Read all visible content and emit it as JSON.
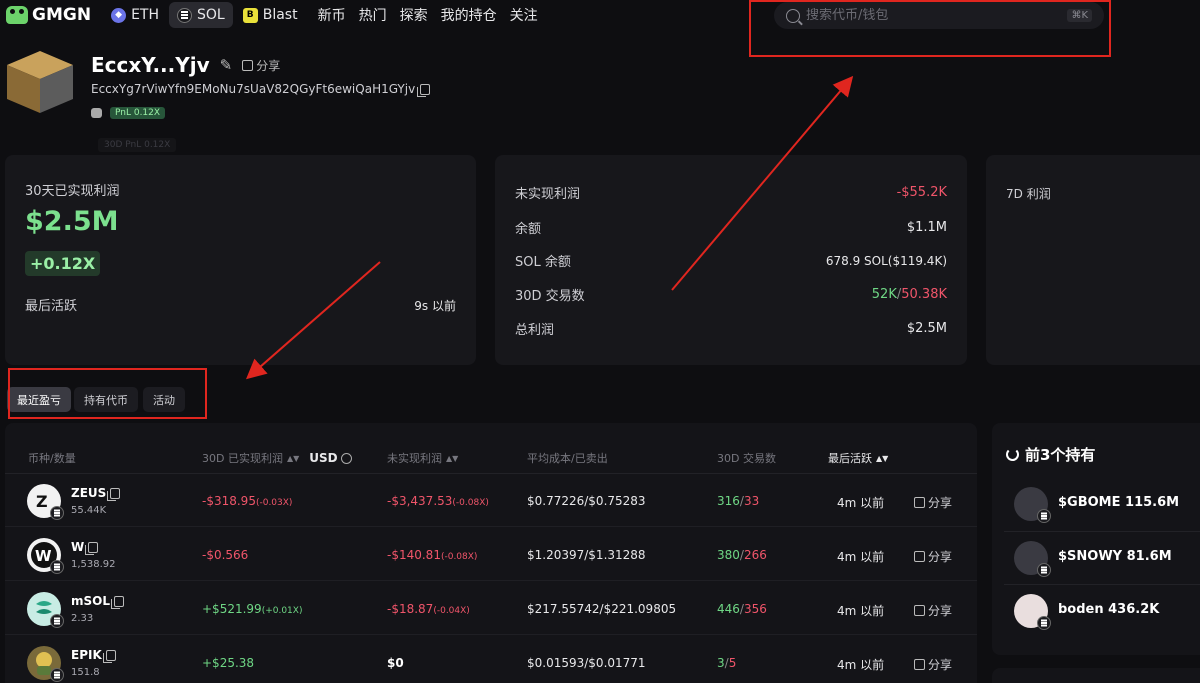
{
  "nav": {
    "logo": "GMGN",
    "chains": [
      {
        "label": "ETH",
        "active": false
      },
      {
        "label": "SOL",
        "active": true
      },
      {
        "label": "Blast",
        "active": false
      }
    ],
    "links": [
      "新币",
      "热门",
      "探索",
      "我的持仓",
      "关注"
    ],
    "search_placeholder": "搜索代币/钱包",
    "search_shortcut": "⌘K"
  },
  "profile": {
    "name": "EccxY...Yjv",
    "share_label": "分享",
    "address": "EccxYg7rViwYfn9EMoNu7sUaV82QGyFt6ewiQaH1GYjv",
    "pnl_badge": "PnL 0.12X",
    "pnl_faded": "30D PnL 0.12X"
  },
  "card_realized": {
    "label": "30天已实现利润",
    "value": "$2.5M",
    "multiplier": "+0.12X",
    "last_active_label": "最后活跃",
    "last_active_value": "9s 以前"
  },
  "card_stats": {
    "unrealized_label": "未实现利润",
    "unrealized_value": "-$55.2K",
    "balance_label": "余额",
    "balance_value": "$1.1M",
    "sol_balance_label": "SOL 余额",
    "sol_balance_value": "678.9 SOL($119.4K)",
    "tx_label": "30D 交易数",
    "tx_buy": "52K",
    "tx_sell": "50.38K",
    "total_profit_label": "总利润",
    "total_profit_value": "$2.5M"
  },
  "card_7d": {
    "label": "7D 利润"
  },
  "tabs": [
    {
      "label": "最近盈亏",
      "active": true
    },
    {
      "label": "持有代币",
      "active": false
    },
    {
      "label": "活动",
      "active": false
    }
  ],
  "table": {
    "headers": {
      "token": "币种/数量",
      "realized": "30D 已实现利润",
      "currency": "USD",
      "unrealized": "未实现利润",
      "avg_cost": "平均成本/已卖出",
      "trades": "30D 交易数",
      "last_active": "最后活跃"
    },
    "rows": [
      {
        "name": "ZEUS",
        "qty": "55.44K",
        "realized": "-$318.95",
        "realized_mult": "(-0.03X)",
        "unrealized": "-$3,437.53",
        "unrealized_mult": "(-0.08X)",
        "avg_cost": "$0.77226/$0.75283",
        "buys": "316",
        "sells": "33",
        "time": "4m 以前",
        "share": "分享"
      },
      {
        "name": "W",
        "qty": "1,538.92",
        "realized": "-$0.566",
        "realized_mult": "",
        "unrealized": "-$140.81",
        "unrealized_mult": "(-0.08X)",
        "avg_cost": "$1.20397/$1.31288",
        "buys": "380",
        "sells": "266",
        "time": "4m 以前",
        "share": "分享"
      },
      {
        "name": "mSOL",
        "qty": "2.33",
        "realized": "+$521.99",
        "realized_mult": "(+0.01X)",
        "unrealized": "-$18.87",
        "unrealized_mult": "(-0.04X)",
        "avg_cost": "$217.55742/$221.09805",
        "buys": "446",
        "sells": "356",
        "time": "4m 以前",
        "share": "分享"
      },
      {
        "name": "EPIK",
        "qty": "151.8",
        "realized": "+$25.38",
        "realized_mult": "",
        "unrealized": "$0",
        "unrealized_mult": "",
        "avg_cost": "$0.01593/$0.01771",
        "buys": "3",
        "sells": "5",
        "time": "4m 以前",
        "share": "分享"
      }
    ]
  },
  "top_holdings": {
    "title": "前3个持有",
    "items": [
      "$GBOME 115.6M",
      "$SNOWY 81.6M",
      "boden 436.2K"
    ]
  },
  "colors": {
    "profit_green": "#7ce08e",
    "loss_red": "#f0556a",
    "annotation_red": "#e0261f"
  }
}
